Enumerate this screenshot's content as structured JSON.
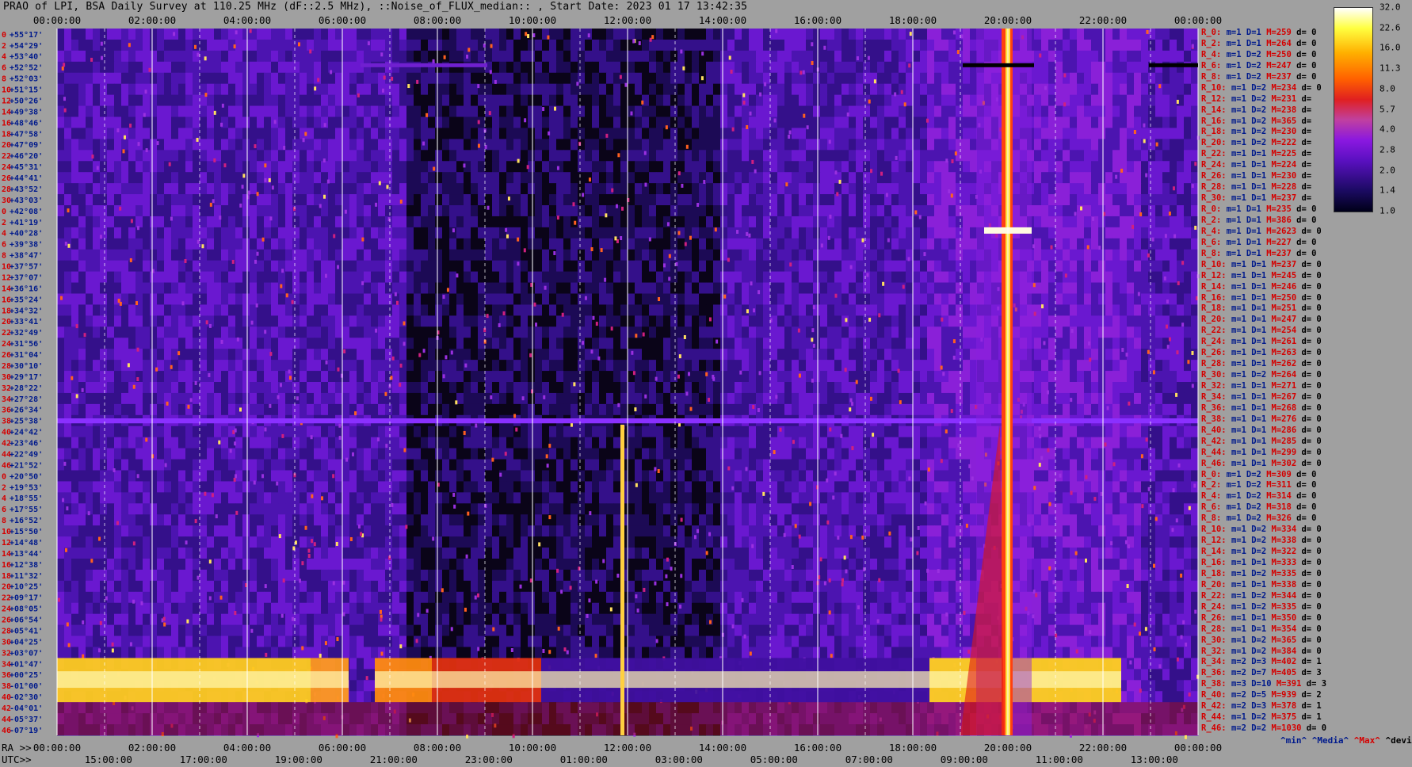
{
  "title": "PRAO of LPI, BSA Daily Survey at 110.25 MHz (dF::2.5 MHz), ::Noise_of_FLUX_median:: , Start Date: 2023 01 17 13:42:35",
  "top_ticks": [
    "00:00:00",
    "02:00:00",
    "04:00:00",
    "06:00:00",
    "08:00:00",
    "10:00:00",
    "12:00:00",
    "14:00:00",
    "16:00:00",
    "18:00:00",
    "20:00:00",
    "22:00:00",
    "00:00:00"
  ],
  "ra_prefix": "RA >>",
  "ra_ticks": [
    "00:00:00",
    "02:00:00",
    "04:00:00",
    "06:00:00",
    "08:00:00",
    "10:00:00",
    "12:00:00",
    "14:00:00",
    "16:00:00",
    "18:00:00",
    "20:00:00",
    "22:00:00",
    "00:00:00"
  ],
  "utc_prefix": "UTC>>",
  "utc_ticks": [
    "15:00:00",
    "17:00:00",
    "19:00:00",
    "21:00:00",
    "23:00:00",
    "01:00:00",
    "03:00:00",
    "05:00:00",
    "07:00:00",
    "09:00:00",
    "11:00:00",
    "13:00:00"
  ],
  "colorbar": {
    "ticks": [
      "32.0",
      "22.6",
      "16.0",
      "11.3",
      "8.0",
      "5.7",
      "4.0",
      "2.8",
      "2.0",
      "1.4",
      "1.0"
    ]
  },
  "legend_bottom": {
    "min": "^min^",
    "media": "^Media^",
    "max": "^Max^",
    "devia": "^devia^"
  },
  "colors": {
    "red": "#d40000",
    "blue": "#001a8c",
    "plot_bg": "#1a0a5a",
    "page_bg": "#a0a0a0"
  },
  "chart_data": {
    "type": "heatmap",
    "title": "PRAO of LPI, BSA Daily Survey at 110.25 MHz (dF::2.5 MHz), ::Noise_of_FLUX_median:: , Start Date: 2023 01 17 13:42:35",
    "x_top_label": "RA",
    "x_bottom_label": "UTC",
    "color_scale": "log",
    "zlim": [
      1.0,
      32.0
    ],
    "declinations": [
      "+55°17'",
      "+54°29'",
      "+53°40'",
      "+52°52'",
      "+52°03'",
      "+51°15'",
      "+50°26'",
      "+49°38'",
      "+48°46'",
      "+47°58'",
      "+47°09'",
      "+46°20'",
      "+45°31'",
      "+44°41'",
      "+43°52'",
      "+43°03'",
      "+42°08'",
      "+41°19'",
      "+40°28'",
      "+39°38'",
      "+38°47'",
      "+37°57'",
      "+37°07'",
      "+36°16'",
      "+35°24'",
      "+34°32'",
      "+33°41'",
      "+32°49'",
      "+31°56'",
      "+31°04'",
      "+30°10'",
      "+29°17'",
      "+28°22'",
      "+27°28'",
      "+26°34'",
      "+25°38'",
      "+24°42'",
      "+23°46'",
      "+22°49'",
      "+21°52'",
      "+20°50'",
      "+19°53'",
      "+18°55'",
      "+17°55'",
      "+16°52'",
      "+15°50'",
      "+14°48'",
      "+13°44'",
      "+12°38'",
      "+11°32'",
      "+10°25'",
      "+09°17'",
      "+08°05'",
      "+06°54'",
      "+05°41'",
      "+04°25'",
      "+03°07'",
      "+01°47'",
      "+00°25'",
      "-01°00'",
      "-02°30'",
      "-04°01'",
      "-05°37'",
      "-07°19'"
    ],
    "row_index": [
      "0",
      "2",
      "4",
      "6",
      "8",
      "10",
      "12",
      "14",
      "16",
      "18",
      "20",
      "22",
      "24",
      "26",
      "28",
      "30",
      "0",
      "2",
      "4",
      "6",
      "8",
      "10",
      "12",
      "14",
      "16",
      "18",
      "20",
      "22",
      "24",
      "26",
      "28",
      "30",
      "32",
      "34",
      "36",
      "38",
      "40",
      "42",
      "44",
      "46",
      "0",
      "2",
      "4",
      "6",
      "8",
      "10",
      "12",
      "14",
      "16",
      "18",
      "20",
      "22",
      "24",
      "26",
      "28",
      "30",
      "32",
      "34",
      "36",
      "38",
      "40",
      "42",
      "44",
      "46"
    ],
    "features": [
      {
        "name": "strong source",
        "ra": "20:00:00",
        "dec_range": [
          "+55°17'",
          "-07°19'"
        ]
      },
      {
        "name": "bright band",
        "dec_range": [
          "+01°47'",
          "-02°30'"
        ]
      },
      {
        "name": "horizontal line",
        "dec": "+25°38'"
      }
    ]
  },
  "stats": [
    {
      "r": "R_0:",
      "m": "m=1",
      "d": "D=1",
      "M": "M=259",
      "dv": "d= 0"
    },
    {
      "r": "R_2:",
      "m": "m=1",
      "d": "D=1",
      "M": "M=264",
      "dv": "d= 0"
    },
    {
      "r": "R_4:",
      "m": "m=1",
      "d": "D=2",
      "M": "M=250",
      "dv": "d= 0"
    },
    {
      "r": "R_6:",
      "m": "m=1",
      "d": "D=2",
      "M": "M=247",
      "dv": "d= 0"
    },
    {
      "r": "R_8:",
      "m": "m=1",
      "d": "D=2",
      "M": "M=237",
      "dv": "d= 0"
    },
    {
      "r": "R_10:",
      "m": "m=1",
      "d": "D=2",
      "M": "M=234",
      "dv": "d= 0"
    },
    {
      "r": "R_12:",
      "m": "m=1",
      "d": "D=2",
      "M": "M=231",
      "dv": "d="
    },
    {
      "r": "R_14:",
      "m": "m=1",
      "d": "D=2",
      "M": "M=238",
      "dv": "d="
    },
    {
      "r": "R_16:",
      "m": "m=1",
      "d": "D=2",
      "M": "M=365",
      "dv": "d="
    },
    {
      "r": "R_18:",
      "m": "m=1",
      "d": "D=2",
      "M": "M=230",
      "dv": "d="
    },
    {
      "r": "R_20:",
      "m": "m=1",
      "d": "D=2",
      "M": "M=222",
      "dv": "d="
    },
    {
      "r": "R_22:",
      "m": "m=1",
      "d": "D=1",
      "M": "M=225",
      "dv": "d="
    },
    {
      "r": "R_24:",
      "m": "m=1",
      "d": "D=1",
      "M": "M=224",
      "dv": "d="
    },
    {
      "r": "R_26:",
      "m": "m=1",
      "d": "D=1",
      "M": "M=230",
      "dv": "d="
    },
    {
      "r": "R_28:",
      "m": "m=1",
      "d": "D=1",
      "M": "M=228",
      "dv": "d="
    },
    {
      "r": "R_30:",
      "m": "m=1",
      "d": "D=1",
      "M": "M=237",
      "dv": "d="
    },
    {
      "r": "R_0:",
      "m": "m=1",
      "d": "D=1",
      "M": "M=235",
      "dv": "d= 0"
    },
    {
      "r": "R_2:",
      "m": "m=1",
      "d": "D=1",
      "M": "M=386",
      "dv": "d= 0"
    },
    {
      "r": "R_4:",
      "m": "m=1",
      "d": "D=1",
      "M": "M=2623",
      "dv": "d= 0"
    },
    {
      "r": "R_6:",
      "m": "m=1",
      "d": "D=1",
      "M": "M=227",
      "dv": "d= 0"
    },
    {
      "r": "R_8:",
      "m": "m=1",
      "d": "D=1",
      "M": "M=237",
      "dv": "d= 0"
    },
    {
      "r": "R_10:",
      "m": "m=1",
      "d": "D=1",
      "M": "M=237",
      "dv": "d= 0"
    },
    {
      "r": "R_12:",
      "m": "m=1",
      "d": "D=1",
      "M": "M=245",
      "dv": "d= 0"
    },
    {
      "r": "R_14:",
      "m": "m=1",
      "d": "D=1",
      "M": "M=246",
      "dv": "d= 0"
    },
    {
      "r": "R_16:",
      "m": "m=1",
      "d": "D=1",
      "M": "M=250",
      "dv": "d= 0"
    },
    {
      "r": "R_18:",
      "m": "m=1",
      "d": "D=1",
      "M": "M=251",
      "dv": "d= 0"
    },
    {
      "r": "R_20:",
      "m": "m=1",
      "d": "D=1",
      "M": "M=247",
      "dv": "d= 0"
    },
    {
      "r": "R_22:",
      "m": "m=1",
      "d": "D=1",
      "M": "M=254",
      "dv": "d= 0"
    },
    {
      "r": "R_24:",
      "m": "m=1",
      "d": "D=1",
      "M": "M=261",
      "dv": "d= 0"
    },
    {
      "r": "R_26:",
      "m": "m=1",
      "d": "D=1",
      "M": "M=263",
      "dv": "d= 0"
    },
    {
      "r": "R_28:",
      "m": "m=1",
      "d": "D=1",
      "M": "M=262",
      "dv": "d= 0"
    },
    {
      "r": "R_30:",
      "m": "m=1",
      "d": "D=2",
      "M": "M=264",
      "dv": "d= 0"
    },
    {
      "r": "R_32:",
      "m": "m=1",
      "d": "D=1",
      "M": "M=271",
      "dv": "d= 0"
    },
    {
      "r": "R_34:",
      "m": "m=1",
      "d": "D=1",
      "M": "M=267",
      "dv": "d= 0"
    },
    {
      "r": "R_36:",
      "m": "m=1",
      "d": "D=1",
      "M": "M=268",
      "dv": "d= 0"
    },
    {
      "r": "R_38:",
      "m": "m=1",
      "d": "D=1",
      "M": "M=276",
      "dv": "d= 0"
    },
    {
      "r": "R_40:",
      "m": "m=1",
      "d": "D=1",
      "M": "M=286",
      "dv": "d= 0"
    },
    {
      "r": "R_42:",
      "m": "m=1",
      "d": "D=1",
      "M": "M=285",
      "dv": "d= 0"
    },
    {
      "r": "R_44:",
      "m": "m=1",
      "d": "D=1",
      "M": "M=299",
      "dv": "d= 0"
    },
    {
      "r": "R_46:",
      "m": "m=1",
      "d": "D=1",
      "M": "M=302",
      "dv": "d= 0"
    },
    {
      "r": "R_0:",
      "m": "m=1",
      "d": "D=2",
      "M": "M=309",
      "dv": "d= 0"
    },
    {
      "r": "R_2:",
      "m": "m=1",
      "d": "D=2",
      "M": "M=311",
      "dv": "d= 0"
    },
    {
      "r": "R_4:",
      "m": "m=1",
      "d": "D=2",
      "M": "M=314",
      "dv": "d= 0"
    },
    {
      "r": "R_6:",
      "m": "m=1",
      "d": "D=2",
      "M": "M=318",
      "dv": "d= 0"
    },
    {
      "r": "R_8:",
      "m": "m=1",
      "d": "D=2",
      "M": "M=326",
      "dv": "d= 0"
    },
    {
      "r": "R_10:",
      "m": "m=1",
      "d": "D=2",
      "M": "M=334",
      "dv": "d= 0"
    },
    {
      "r": "R_12:",
      "m": "m=1",
      "d": "D=2",
      "M": "M=338",
      "dv": "d= 0"
    },
    {
      "r": "R_14:",
      "m": "m=1",
      "d": "D=2",
      "M": "M=322",
      "dv": "d= 0"
    },
    {
      "r": "R_16:",
      "m": "m=1",
      "d": "D=1",
      "M": "M=333",
      "dv": "d= 0"
    },
    {
      "r": "R_18:",
      "m": "m=1",
      "d": "D=2",
      "M": "M=335",
      "dv": "d= 0"
    },
    {
      "r": "R_20:",
      "m": "m=1",
      "d": "D=1",
      "M": "M=338",
      "dv": "d= 0"
    },
    {
      "r": "R_22:",
      "m": "m=1",
      "d": "D=2",
      "M": "M=344",
      "dv": "d= 0"
    },
    {
      "r": "R_24:",
      "m": "m=1",
      "d": "D=2",
      "M": "M=335",
      "dv": "d= 0"
    },
    {
      "r": "R_26:",
      "m": "m=1",
      "d": "D=1",
      "M": "M=350",
      "dv": "d= 0"
    },
    {
      "r": "R_28:",
      "m": "m=1",
      "d": "D=1",
      "M": "M=354",
      "dv": "d= 0"
    },
    {
      "r": "R_30:",
      "m": "m=1",
      "d": "D=2",
      "M": "M=365",
      "dv": "d= 0"
    },
    {
      "r": "R_32:",
      "m": "m=1",
      "d": "D=2",
      "M": "M=384",
      "dv": "d= 0"
    },
    {
      "r": "R_34:",
      "m": "m=2",
      "d": "D=3",
      "M": "M=402",
      "dv": "d= 1"
    },
    {
      "r": "R_36:",
      "m": "m=2",
      "d": "D=7",
      "M": "M=405",
      "dv": "d= 3"
    },
    {
      "r": "R_38:",
      "m": "m=3",
      "d": "D=10",
      "M": "M=391",
      "dv": "d= 3"
    },
    {
      "r": "R_40:",
      "m": "m=2",
      "d": "D=5",
      "M": "M=939",
      "dv": "d= 2"
    },
    {
      "r": "R_42:",
      "m": "m=2",
      "d": "D=3",
      "M": "M=378",
      "dv": "d= 1"
    },
    {
      "r": "R_44:",
      "m": "m=1",
      "d": "D=2",
      "M": "M=375",
      "dv": "d= 1"
    },
    {
      "r": "R_46:",
      "m": "m=2",
      "d": "D=2",
      "M": "M=1030",
      "dv": "d= 0"
    }
  ]
}
